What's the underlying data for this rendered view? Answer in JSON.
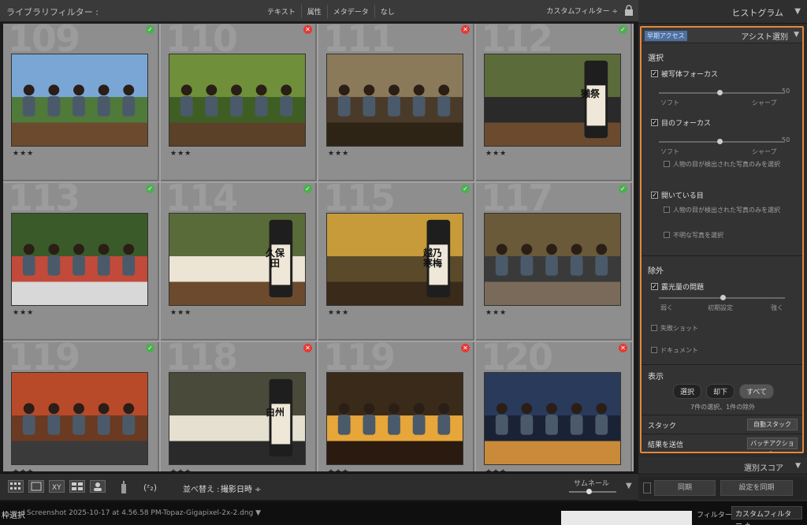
{
  "filterbar": {
    "title": "ライブラリフィルター :",
    "modes": [
      "テキスト",
      "属性",
      "メタデータ",
      "なし"
    ],
    "custom": "カスタムフィルター ÷"
  },
  "grid": {
    "cells": [
      {
        "num": "109",
        "flag": "pick",
        "stars": "★★★",
        "scene": "couple"
      },
      {
        "num": "110",
        "flag": "reject",
        "stars": "★★★",
        "scene": "garden"
      },
      {
        "num": "111",
        "flag": "reject",
        "stars": "★★★",
        "scene": "group"
      },
      {
        "num": "112",
        "flag": "pick",
        "stars": "★★★",
        "scene": "sake"
      },
      {
        "num": "113",
        "flag": "pick",
        "stars": "★★★",
        "scene": "sashimi"
      },
      {
        "num": "114",
        "flag": "pick",
        "stars": "★★★",
        "scene": "kubota"
      },
      {
        "num": "115",
        "flag": "pick",
        "stars": "★★★",
        "scene": "fish"
      },
      {
        "num": "117",
        "flag": "pick",
        "stars": "★★★",
        "scene": "table"
      },
      {
        "num": "119",
        "flag": "pick",
        "stars": "★★★",
        "scene": "autumn"
      },
      {
        "num": "118",
        "flag": "reject",
        "stars": "★★★",
        "scene": "hakushu"
      },
      {
        "num": "119",
        "flag": "reject",
        "stars": "★★★",
        "scene": "lanterns"
      },
      {
        "num": "120",
        "flag": "reject",
        "stars": "★★★",
        "scene": "pagoda"
      }
    ],
    "bottle_labels": {
      "sake": "獺祭",
      "kubota": "久保田",
      "fish": "越乃寒梅",
      "hakushu": "白州"
    }
  },
  "toolbar": {
    "sort_label": "並べ替え :",
    "sort_value": "撮影日時 ÷",
    "thumb_label": "サムネール"
  },
  "status": {
    "selection": "枠選択",
    "file": "/ Screenshot 2025-10-17 at 4.56.58 PM-Topaz-Gigapixel-2x-2.dng ▼",
    "filter_label": "フィルター :",
    "filter_value": "カスタムフィルター ÷"
  },
  "rpanel": {
    "histogram": "ヒストグラム",
    "assist": {
      "tag": "早期アクセス",
      "title": "アシスト選別",
      "select_header": "選択",
      "subject_focus": "被写体フォーカス",
      "range_min": "ソフト",
      "range_max": "シャープ",
      "range_value": "50",
      "eye_focus": "目のフォーカス",
      "eye_range_value": "50",
      "eye_sub": "人物の目が検出された写真のみを選択",
      "open_eyes": "開いている目",
      "open_sub1": "人物の目が検出された写真のみを選択",
      "open_sub2": "不明な写真を選択",
      "exclude_header": "除外",
      "exposure": "露光量の問題",
      "exp_min": "弱く",
      "exp_mid": "初期設定",
      "exp_max": "強く",
      "failed": "失敗ショット",
      "document": "ドキュメント",
      "display_header": "表示",
      "seg": [
        "選択",
        "却下",
        "すべて"
      ],
      "summary": "7件の選択、1件の除外",
      "stack_label": "スタック",
      "stack_btn": "自動スタック",
      "send_label": "結果を送信",
      "send_btn": "バッチアクション"
    },
    "select_score": "選別スコア",
    "sync1": "同期",
    "sync2": "設定を同期"
  }
}
